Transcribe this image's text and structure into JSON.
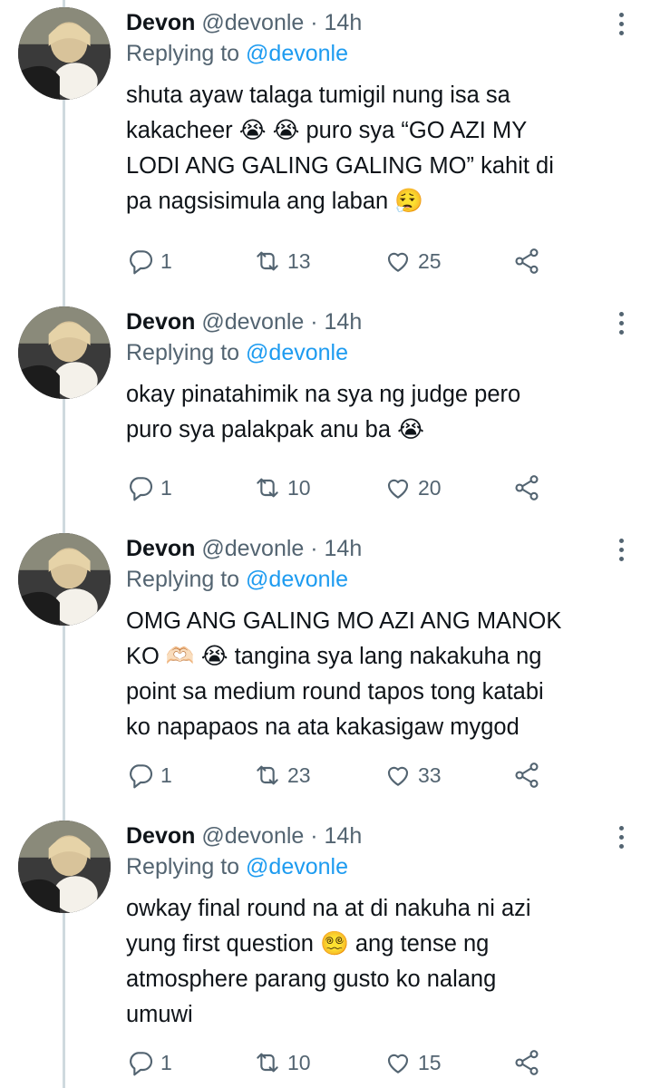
{
  "tweets": [
    {
      "author": "Devon",
      "meta": " @devonle · 14h",
      "replying_prefix": "Replying to ",
      "replying_handle": "@devonle",
      "lines": [
        "shuta ayaw talaga tumigil nung isa sa",
        "kakacheer 😭 😭  puro sya “GO AZI MY",
        "LODI ANG GALING GALING MO” kahit di",
        "pa nagsisimula ang laban 😮‍💨"
      ],
      "replies": "1",
      "retweets": "13",
      "likes": "25"
    },
    {
      "author": "Devon",
      "meta": " @devonle · 14h",
      "replying_prefix": "Replying to ",
      "replying_handle": "@devonle",
      "lines": [
        "okay pinatahimik na sya ng judge pero",
        "puro sya palakpak anu ba 😭"
      ],
      "replies": "1",
      "retweets": "10",
      "likes": "20"
    },
    {
      "author": "Devon",
      "meta": " @devonle · 14h",
      "replying_prefix": "Replying to ",
      "replying_handle": "@devonle",
      "lines": [
        "OMG ANG GALING MO AZI ANG MANOK",
        "KO 🫶🏻 😭  tangina sya lang nakakuha ng",
        "point sa medium round tapos tong katabi",
        "ko napapaos na ata kakasigaw mygod"
      ],
      "replies": "1",
      "retweets": "23",
      "likes": "33"
    },
    {
      "author": "Devon",
      "meta": " @devonle · 14h",
      "replying_prefix": "Replying to ",
      "replying_handle": "@devonle",
      "lines": [
        "owkay final round na at di nakuha ni azi",
        "yung first question 😵‍💫  ang tense ng",
        "atmosphere parang gusto ko nalang",
        "umuwi"
      ],
      "replies": "1",
      "retweets": "10",
      "likes": "15"
    }
  ],
  "colors": {
    "text": "#0f1419",
    "secondary": "#536471",
    "link": "#1d9bf0",
    "thread_line": "#cfd9de"
  },
  "icons": [
    "reply-icon",
    "retweet-icon",
    "like-icon",
    "share-icon",
    "more-icon"
  ]
}
